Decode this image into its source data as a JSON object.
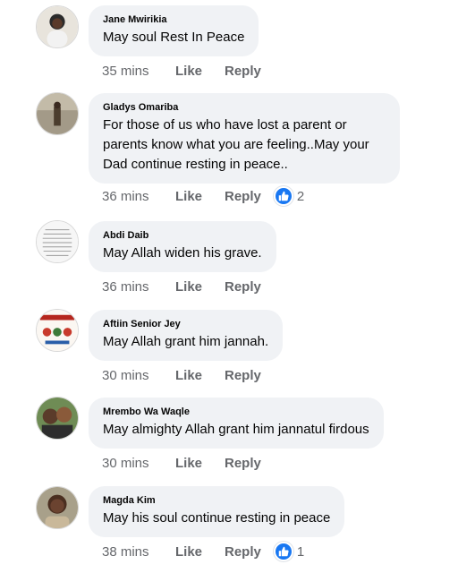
{
  "comments": [
    {
      "name": "Jane Mwirikia",
      "text": "May soul Rest In Peace",
      "time": "35 mins",
      "like": "Like",
      "reply": "Reply",
      "reaction_count": null,
      "avatar_color": "#3a3a3a"
    },
    {
      "name": "Gladys Omariba",
      "text": "For those of us who have lost a parent or parents know what you are feeling..May your Dad continue resting in peace..",
      "time": "36 mins",
      "like": "Like",
      "reply": "Reply",
      "reaction_count": "2",
      "avatar_color": "#8a8070"
    },
    {
      "name": "Abdi Daib",
      "text": "May Allah widen his grave.",
      "time": "36 mins",
      "like": "Like",
      "reply": "Reply",
      "reaction_count": null,
      "avatar_color": "#f4f4f4"
    },
    {
      "name": "Aftiin Senior Jey",
      "text": "May Allah grant him jannah.",
      "time": "30 mins",
      "like": "Like",
      "reply": "Reply",
      "reaction_count": null,
      "avatar_color": "#f7f2ee"
    },
    {
      "name": "Mrembo Wa Waqle",
      "text": "May almighty Allah grant him jannatul firdous",
      "time": "30 mins",
      "like": "Like",
      "reply": "Reply",
      "reaction_count": null,
      "avatar_color": "#4a6b3a"
    },
    {
      "name": "Magda Kim",
      "text": "May his soul continue resting in peace",
      "time": "38 mins",
      "like": "Like",
      "reply": "Reply",
      "reaction_count": "1",
      "avatar_color": "#5a4030"
    }
  ],
  "colors": {
    "bubble": "#f0f2f5",
    "meta": "#65676b",
    "reaction": "#1877f2"
  },
  "icons": {
    "reaction": "like-thumbs-up-icon"
  }
}
